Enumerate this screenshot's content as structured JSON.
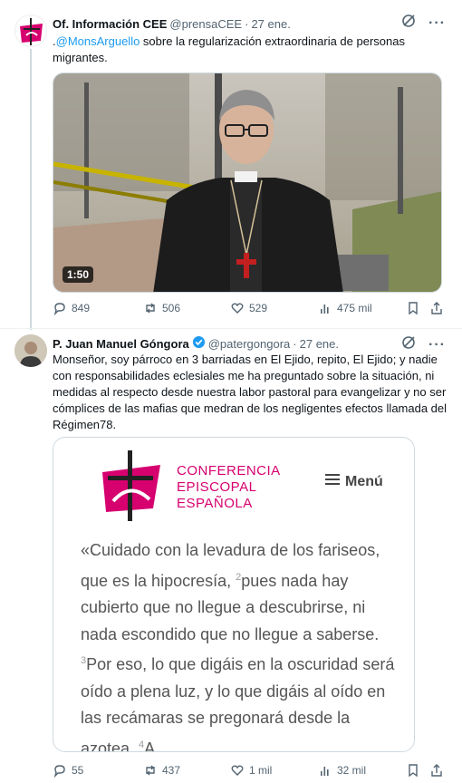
{
  "tweet1": {
    "author_name": "Of. Información CEE",
    "handle": "@prensaCEE",
    "separator": "·",
    "date": "27 ene.",
    "text_prefix": ".",
    "mention": "@MonsArguello",
    "text_rest": " sobre la regularización extraordinaria de personas migrantes.",
    "video_duration": "1:50",
    "replies": "849",
    "reposts": "506",
    "likes": "529",
    "views": "475 mil"
  },
  "tweet2": {
    "author_name": "P. Juan Manuel Góngora",
    "handle": "@patergongora",
    "separator": "·",
    "date": "27 ene.",
    "text": "Monseñor, soy párroco en 3 barriadas en El Ejido, repito, El Ejido; y nadie con responsabilidades eclesiales me ha preguntado sobre la situación, ni medidas al respecto desde nuestra labor pastoral para evangelizar y no ser cómplices de las mafias que medran de los negligentes efectos llamada del Régimen78.",
    "card": {
      "logo_line1": "CONFERENCIA",
      "logo_line2": "EPISCOPAL",
      "logo_line3": "ESPAÑOLA",
      "menu_label": "Menú",
      "quote_part1": "«Cuidado con la levadura de los fariseos, que es la hipocresía, ",
      "sup1": "2",
      "quote_part2": "pues nada hay cubierto que no llegue a descubrirse, ni nada escondido que no llegue a saberse. ",
      "sup2": "3",
      "quote_part3": "Por eso, lo que digáis en la oscuridad será oído a plena luz, y lo que digáis al oído en las recámaras se pregonará desde la azotea. ",
      "sup3": "4",
      "quote_part4": "A"
    },
    "replies": "55",
    "reposts": "437",
    "likes": "1 mil",
    "views": "32 mil"
  },
  "colors": {
    "link": "#1d9bf0",
    "secondary_text": "#536471",
    "brand_magenta": "#d6006f",
    "verified": "#1d9bf0"
  },
  "icons": [
    "grok-icon",
    "more-icon",
    "reply-icon",
    "repost-icon",
    "like-icon",
    "views-icon",
    "bookmark-icon",
    "share-icon",
    "verified-badge-icon",
    "menu-hamburger-icon"
  ]
}
